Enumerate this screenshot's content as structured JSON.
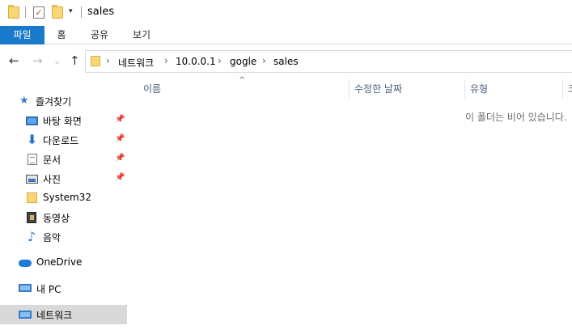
{
  "titlebar": {
    "title": "sales",
    "quick_access": [
      {
        "name": "folder-icon"
      },
      {
        "name": "properties-check-icon"
      },
      {
        "name": "new-folder-icon"
      }
    ],
    "dropdown_glyph": "▾"
  },
  "ribbon": {
    "tabs": [
      {
        "label": "파일"
      },
      {
        "label": "홈"
      },
      {
        "label": "공유"
      },
      {
        "label": "보기"
      }
    ]
  },
  "nav_buttons": {
    "back": "←",
    "forward": "→",
    "recent": "⌄",
    "up": "↑"
  },
  "address": {
    "separator": "›",
    "crumbs": [
      "네트워크",
      "10.0.0.1",
      "gogle",
      "sales"
    ]
  },
  "nav_pane": {
    "quick_access_label": "즐겨찾기",
    "pinned": [
      {
        "label": "바탕 화면",
        "icon": "desktop-icon",
        "pinned": true
      },
      {
        "label": "다운로드",
        "icon": "download-icon",
        "pinned": true
      },
      {
        "label": "문서",
        "icon": "document-icon",
        "pinned": true
      },
      {
        "label": "사진",
        "icon": "pictures-icon",
        "pinned": true
      },
      {
        "label": "System32",
        "icon": "folder-icon",
        "pinned": false
      },
      {
        "label": "동영상",
        "icon": "video-icon",
        "pinned": false
      },
      {
        "label": "음악",
        "icon": "music-icon",
        "pinned": false
      }
    ],
    "onedrive_label": "OneDrive",
    "this_pc_label": "내 PC",
    "network_label": "네트워크",
    "pin_glyph": "📌"
  },
  "content": {
    "sort_glyph": "^",
    "columns": [
      {
        "label": "이름"
      },
      {
        "label": "수정한 날짜"
      },
      {
        "label": "유형"
      },
      {
        "label": "크"
      }
    ],
    "empty_message": "이 폴더는 비어 있습니다."
  },
  "colors": {
    "accent": "#1979ca",
    "selection": "#d9d9d9",
    "header_text": "#4c607a"
  }
}
